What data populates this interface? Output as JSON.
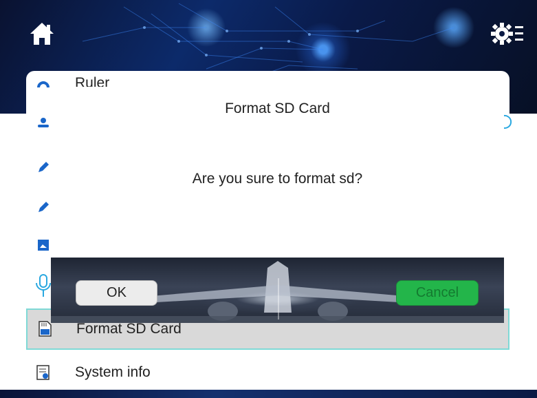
{
  "header": {
    "home_icon": "home-icon",
    "settings_icon": "settings-menu-icon"
  },
  "menu": {
    "items": [
      {
        "label": "Ruler",
        "icon": "ruler-icon"
      },
      {
        "label": "",
        "icon": "user-icon"
      },
      {
        "label": "",
        "icon": "pen-icon"
      },
      {
        "label": "",
        "icon": "pencil-icon"
      },
      {
        "label": "",
        "icon": "image-icon"
      },
      {
        "label": "",
        "icon": "microphone-icon"
      },
      {
        "label": "Format SD Card",
        "icon": "sd-card-icon",
        "selected": true
      },
      {
        "label": "System info",
        "icon": "system-info-icon"
      }
    ]
  },
  "dialog": {
    "title": "Format SD Card",
    "message": "Are you sure to format sd?",
    "ok_label": "OK",
    "cancel_label": "Cancel"
  },
  "colors": {
    "accent_blue": "#1a66c9",
    "cancel_green": "#23b54a",
    "selection_border": "#7fd9d6",
    "selection_bg": "#d9d9d9"
  }
}
